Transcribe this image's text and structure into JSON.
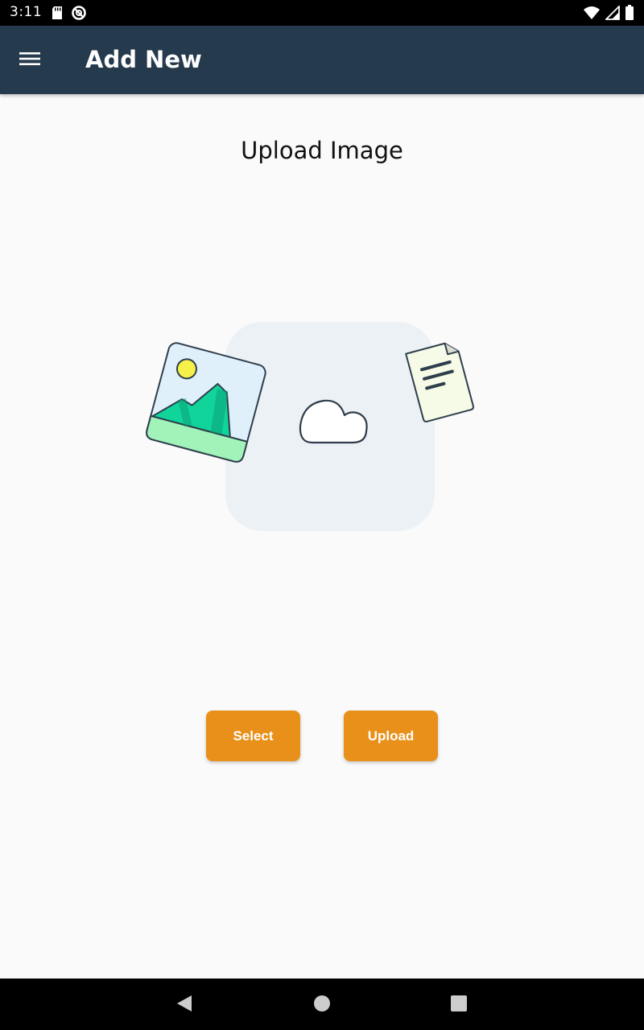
{
  "status_bar": {
    "time": "3:11",
    "icons": [
      "sd-card-icon",
      "do-not-disturb-icon",
      "wifi-icon",
      "signal-icon",
      "battery-icon"
    ]
  },
  "app_bar": {
    "title": "Add New",
    "menu_icon": "menu-icon",
    "background_color": "#263a4e"
  },
  "main": {
    "heading": "Upload Image",
    "illustration_icons": [
      "image-icon",
      "cloud-icon",
      "document-icon"
    ]
  },
  "actions": {
    "select_label": "Select",
    "upload_label": "Upload",
    "button_color": "#e8901a"
  },
  "nav_bar": {
    "icons": [
      "back-icon",
      "home-icon",
      "recents-icon"
    ]
  }
}
